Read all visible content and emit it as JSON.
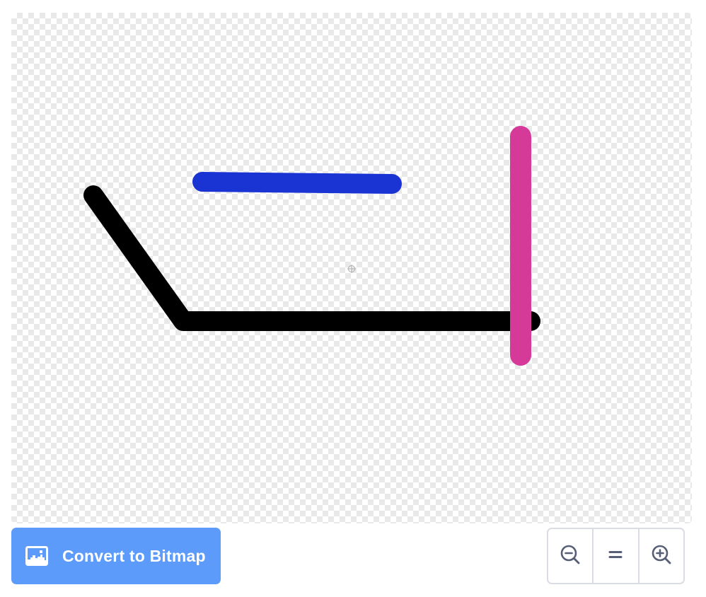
{
  "canvas": {
    "background": "transparent-checkerboard",
    "center_marker_icon": "crosshair-icon",
    "strokes": [
      {
        "name": "black-polyline",
        "color": "#000000"
      },
      {
        "name": "blue-line",
        "color": "#1a34d4"
      },
      {
        "name": "pink-line",
        "color": "#d63a99"
      }
    ]
  },
  "toolbar": {
    "convert_label": "Convert to Bitmap",
    "convert_icon": "bitmap-icon",
    "accent_color": "#5c9bf9"
  },
  "zoom": {
    "zoom_out_icon": "zoom-out-icon",
    "reset_icon": "zoom-reset-icon",
    "zoom_in_icon": "zoom-in-icon"
  }
}
